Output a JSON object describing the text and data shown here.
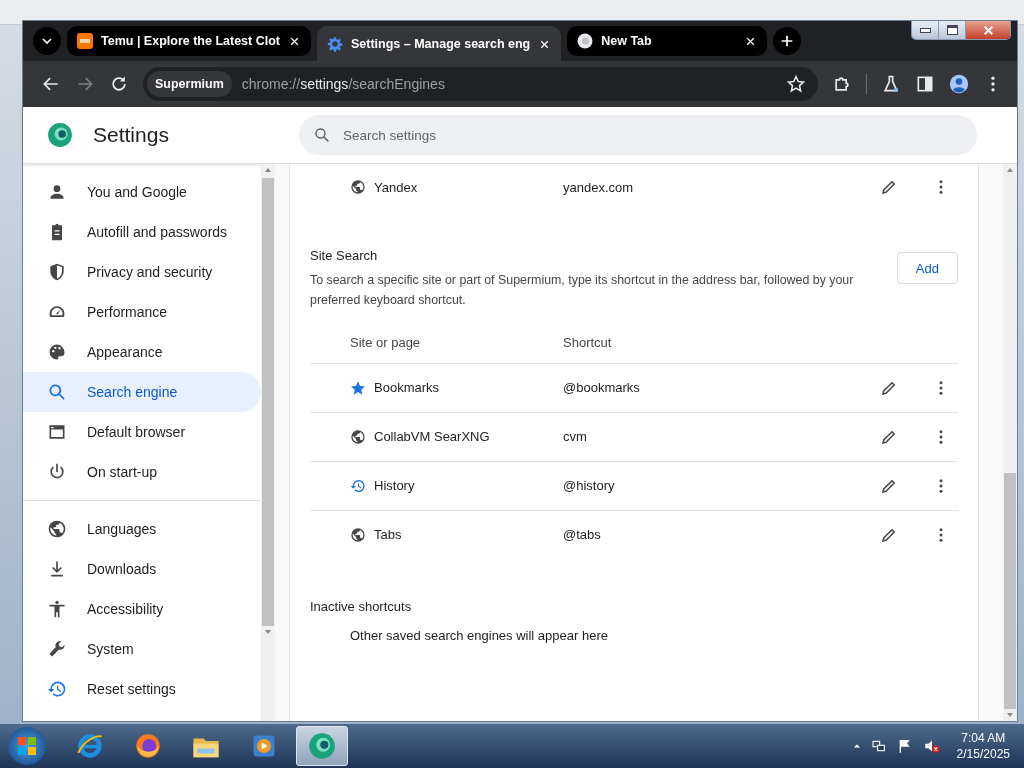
{
  "tabs": [
    {
      "title": "Temu | Explore the Latest Clot",
      "kind": "temu",
      "selected": false
    },
    {
      "title": "Settings – Manage search eng",
      "kind": "gear",
      "selected": true
    },
    {
      "title": "New Tab",
      "kind": "browser",
      "selected": false
    }
  ],
  "toolbar": {
    "site_chip": "Supermium",
    "url_prefix": "chrome://",
    "url_host": "settings",
    "url_path": "/searchEngines"
  },
  "header": {
    "title": "Settings",
    "search": {
      "placeholder": "Search settings"
    }
  },
  "sidebar": {
    "sections": [
      {
        "items": [
          {
            "label": "You and Google",
            "kind": "person",
            "selected": false
          },
          {
            "label": "Autofill and passwords",
            "kind": "clipboard",
            "selected": false
          },
          {
            "label": "Privacy and security",
            "kind": "shield",
            "selected": false
          },
          {
            "label": "Performance",
            "kind": "gauge",
            "selected": false
          },
          {
            "label": "Appearance",
            "kind": "palette",
            "selected": false
          },
          {
            "label": "Search engine",
            "kind": "search",
            "selected": true
          },
          {
            "label": "Default browser",
            "kind": "browser",
            "selected": false
          },
          {
            "label": "On start-up",
            "kind": "power",
            "selected": false
          }
        ]
      },
      {
        "items": [
          {
            "label": "Languages",
            "kind": "globe",
            "selected": false
          },
          {
            "label": "Downloads",
            "kind": "download",
            "selected": false
          },
          {
            "label": "Accessibility",
            "kind": "accessibility",
            "selected": false
          },
          {
            "label": "System",
            "kind": "wrench",
            "selected": false
          },
          {
            "label": "Reset settings",
            "kind": "history",
            "selected": false
          }
        ]
      }
    ]
  },
  "content": {
    "top_rows": [
      {
        "name": "Yandex",
        "shortcut": "yandex.com",
        "kind": "globe"
      }
    ],
    "site_search": {
      "title": "Site Search",
      "description": "To search a specific site or part of Supermium, type its shortcut in the address bar, followed by your preferred keyboard shortcut.",
      "add_button": "Add",
      "columns": [
        "Site or page",
        "Shortcut"
      ],
      "rows": [
        {
          "name": "Bookmarks",
          "shortcut": "@bookmarks",
          "kind": "star"
        },
        {
          "name": "CollabVM SearXNG",
          "shortcut": "cvm",
          "kind": "globe"
        },
        {
          "name": "History",
          "shortcut": "@history",
          "kind": "history"
        },
        {
          "name": "Tabs",
          "shortcut": "@tabs",
          "kind": "globe"
        }
      ]
    },
    "inactive": {
      "title": "Inactive shortcuts",
      "message": "Other saved search engines will appear here"
    }
  },
  "taskbar": {
    "apps": [
      {
        "kind": "ie",
        "selected": false
      },
      {
        "kind": "firefox",
        "selected": false
      },
      {
        "kind": "folder",
        "selected": false
      },
      {
        "kind": "media",
        "selected": false
      },
      {
        "kind": "supermium",
        "selected": true
      }
    ],
    "time": "7:04 AM",
    "date": "2/15/2025"
  }
}
